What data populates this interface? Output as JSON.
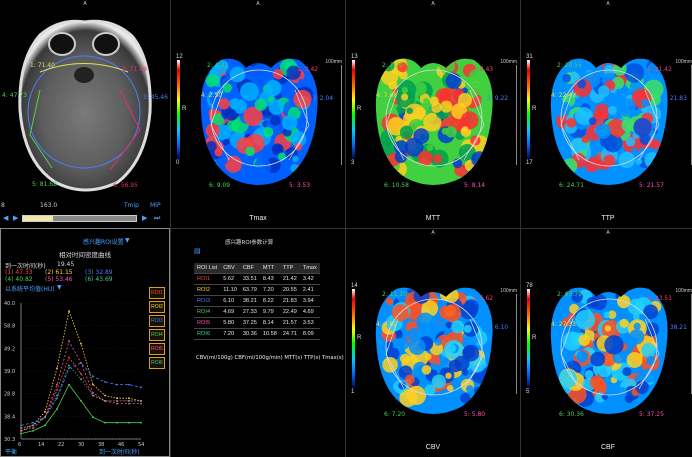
{
  "orientation": {
    "anterior": "A"
  },
  "ct": {
    "rois": [
      {
        "tag": "1: 71.40",
        "color": "#e0e050"
      },
      {
        "tag": "2: 71.89",
        "color": "#e03070"
      },
      {
        "tag": "4: 47.73",
        "color": "#50d050"
      },
      {
        "tag": "3: 45.46",
        "color": "#4a7dff"
      },
      {
        "tag": "5: 81.68",
        "color": "#50d050"
      },
      {
        "tag": "6: 56.95",
        "color": "#e03070"
      }
    ],
    "window": {
      "level": "8",
      "width": "163.0"
    },
    "tmip_label": "Tmip",
    "mip_label": "MIP"
  },
  "maps": [
    {
      "name": "Tmax",
      "scale_max": "12",
      "scale_min": "0",
      "r_label": "R",
      "mm": "100mm",
      "tags": [
        "2: 4.41",
        "1: 3.42",
        "4: 2.50",
        "3: 2.04",
        "6: 9.09",
        "5: 3.53"
      ]
    },
    {
      "name": "MTT",
      "scale_max": "13",
      "scale_min": "3",
      "r_label": "R",
      "mm": "100mm",
      "tags": [
        "2: 7.20",
        "1: 8.43",
        "4: 7.66",
        "3: 9.22",
        "6: 10.58",
        "5: 8.14"
      ]
    },
    {
      "name": "TTP",
      "scale_max": "31",
      "scale_min": "17",
      "r_label": "R",
      "mm": "100mm",
      "tags": [
        "2: 20.55",
        "1: 21.42",
        "4: 22.49",
        "3: 21.83",
        "6: 24.71",
        "5: 21.57"
      ]
    },
    {
      "name": "CBV",
      "scale_max": "14",
      "scale_min": "1",
      "r_label": "R",
      "mm": "100mm",
      "tags": [
        "2: 11.10",
        "1: 5.62",
        "4: 4.69",
        "3: 6.10",
        "6: 7.20",
        "5: 5.80"
      ]
    },
    {
      "name": "CBF",
      "scale_max": "78",
      "scale_min": "5",
      "r_label": "R",
      "mm": "100mm",
      "tags": [
        "2: 63.79",
        "1: 33.51",
        "4: 27.33",
        "3: 38.21",
        "6: 30.36",
        "5: 37.25"
      ]
    }
  ],
  "roi_table": {
    "title": "感兴趣ROI参数计算",
    "headers": [
      "ROI List",
      "CBV",
      "CBF",
      "MTT",
      "TTP",
      "Tmax"
    ],
    "rows": [
      {
        "name": "ROI1",
        "color": "#ff4040",
        "vals": [
          "5.62",
          "33.51",
          "8.43",
          "21.42",
          "3.42"
        ]
      },
      {
        "name": "ROI2",
        "color": "#ffd23a",
        "vals": [
          "11.10",
          "63.79",
          "7.20",
          "20.55",
          "2.41"
        ]
      },
      {
        "name": "ROI3",
        "color": "#4a7dff",
        "vals": [
          "6.10",
          "38.21",
          "8.22",
          "21.83",
          "3.94"
        ]
      },
      {
        "name": "ROI4",
        "color": "#50d050",
        "vals": [
          "4.69",
          "27.33",
          "9.79",
          "22.49",
          "4.69"
        ]
      },
      {
        "name": "ROI5",
        "color": "#ff4fb0",
        "vals": [
          "5.80",
          "37.25",
          "8.14",
          "21.57",
          "3.53"
        ]
      },
      {
        "name": "ROI6",
        "color": "#37d0a0",
        "vals": [
          "7.20",
          "30.36",
          "10.58",
          "24.71",
          "8.09"
        ]
      }
    ],
    "units": "CBV(ml/100g) CBF(ml/100g/min) MTT(s) TTP(s) Tmax(s)"
  },
  "curve_panel": {
    "dropdown_label": "感兴趣ROI设置",
    "title": "相对时间密度曲线",
    "arrival_label": "到一次时间(秒)",
    "arrival_value": "19.45",
    "legend_items": [
      {
        "id": "(1)",
        "value": "47.33"
      },
      {
        "id": "(2)",
        "value": "61.15"
      },
      {
        "id": "(3)",
        "value": "32.89"
      },
      {
        "id": "(4)",
        "value": "40.82"
      },
      {
        "id": "(5)",
        "value": "53.46"
      },
      {
        "id": "(6)",
        "value": "43.69"
      }
    ],
    "baseline_label": "以系统平均值(HU)",
    "roi_buttons": [
      "ROI1",
      "ROI2",
      "ROI3",
      "ROI4",
      "ROI5",
      "ROI6"
    ],
    "x_axis_label": "到一次时间(秒)",
    "avg_label": "平衡"
  },
  "chart_data": {
    "type": "line",
    "title": "相对时间密度曲线",
    "xlabel": "到一次时间(秒)",
    "ylabel": "",
    "x": [
      6,
      10,
      14,
      18,
      22,
      26,
      30,
      34,
      38,
      42,
      46
    ],
    "xticks": [
      "6",
      "14",
      "22",
      "30",
      "38",
      "46",
      "54"
    ],
    "yticks": [
      "40.0",
      "58.8",
      "49.2",
      "39.0",
      "28.8",
      "38.4",
      "30.3"
    ],
    "ylim": [
      30,
      80
    ],
    "series": [
      {
        "name": "ROI1",
        "color": "#ff4040",
        "values": [
          34,
          35,
          38,
          48,
          60,
          54,
          46,
          44,
          44,
          44,
          44
        ]
      },
      {
        "name": "ROI2",
        "color": "#ffd23a",
        "values": [
          33,
          35,
          40,
          56,
          77,
          65,
          50,
          46,
          45,
          45,
          44
        ]
      },
      {
        "name": "ROI3",
        "color": "#4a7dff",
        "values": [
          35,
          36,
          38,
          45,
          56,
          58,
          53,
          51,
          50,
          50,
          49
        ]
      },
      {
        "name": "ROI4",
        "color": "#50d050",
        "values": [
          32,
          33,
          35,
          41,
          50,
          44,
          38,
          36,
          36,
          36,
          36
        ]
      },
      {
        "name": "ROI5",
        "color": "#ff4fb0",
        "values": [
          33,
          34,
          38,
          50,
          66,
          58,
          47,
          44,
          43,
          43,
          43
        ]
      },
      {
        "name": "ROI6",
        "color": "#37d0a0",
        "values": [
          34,
          35,
          38,
          46,
          57,
          52,
          46,
          44,
          44,
          44,
          44
        ]
      }
    ]
  }
}
